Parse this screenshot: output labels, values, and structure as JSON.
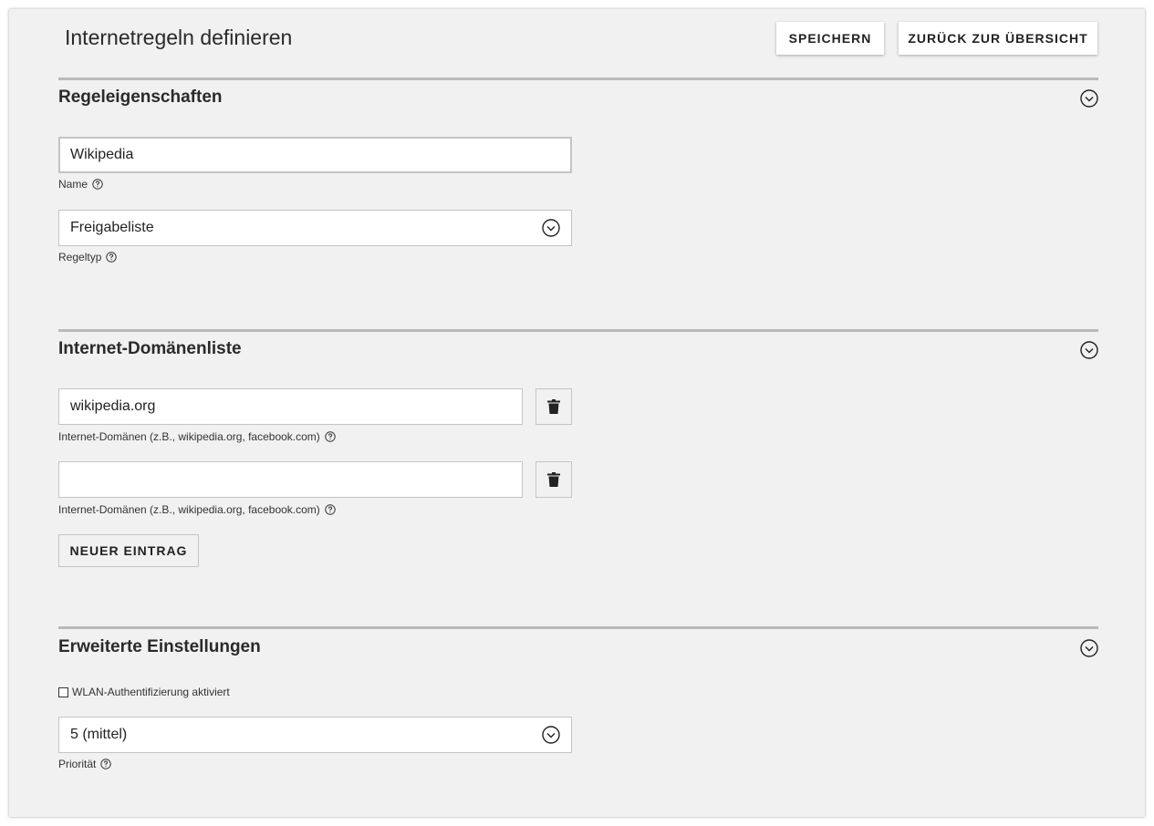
{
  "header": {
    "title": "Internetregeln definieren",
    "save_label": "SPEICHERN",
    "back_label": "ZURÜCK ZUR ÜBERSICHT"
  },
  "rule_properties": {
    "heading": "Regeleigenschaften",
    "name_value": "Wikipedia",
    "name_label": "Name",
    "rule_type_value": "Freigabeliste",
    "rule_type_label": "Regeltyp"
  },
  "domain_list": {
    "heading": "Internet-Domänenliste",
    "entries": [
      {
        "value": "wikipedia.org",
        "label": "Internet-Domänen (z.B., wikipedia.org, facebook.com)"
      },
      {
        "value": "",
        "label": "Internet-Domänen (z.B., wikipedia.org, facebook.com)"
      }
    ],
    "new_entry_label": "NEUER EINTRAG"
  },
  "advanced": {
    "heading": "Erweiterte Einstellungen",
    "wlan_auth_label": "WLAN-Authentifizierung aktiviert",
    "wlan_auth_checked": false,
    "priority_value": "5 (mittel)",
    "priority_label": "Priorität"
  },
  "icons": {
    "collapse": "chevron-circle-icon",
    "help": "help-circle-icon",
    "trash": "trash-icon",
    "dropdown": "chevron-circle-icon"
  }
}
